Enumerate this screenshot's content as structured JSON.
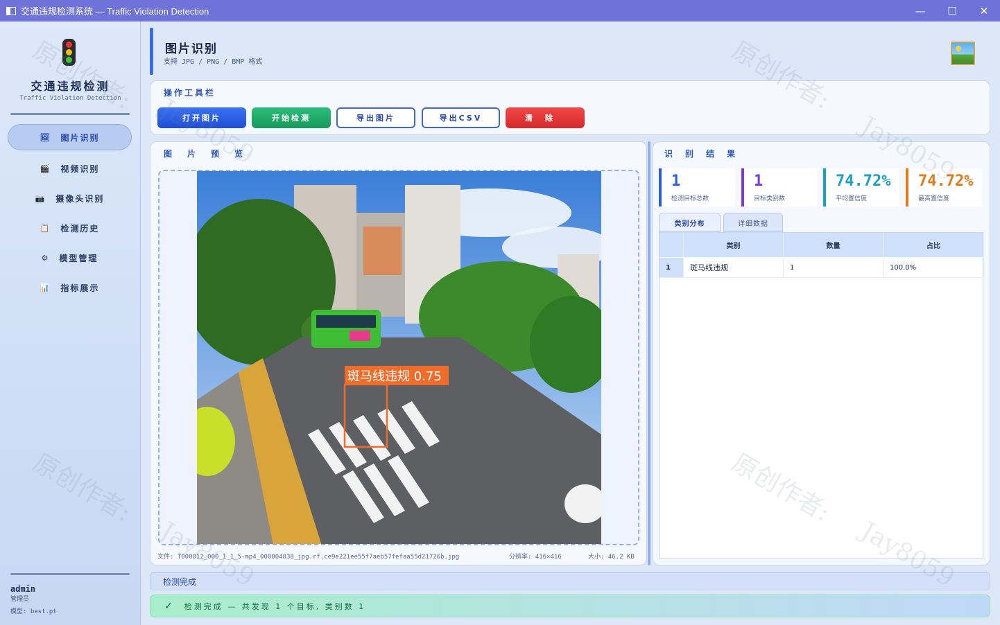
{
  "window": {
    "title": "交通违规检测系统 — Traffic Violation Detection",
    "minimize": "—",
    "maximize": "☐",
    "close": "✕"
  },
  "sidebar": {
    "brand": "交通违规检测",
    "brand_sub": "Traffic Violation Detection",
    "items": [
      {
        "label": "图片识别",
        "icon": "🖼"
      },
      {
        "label": "视频识别",
        "icon": "🎬"
      },
      {
        "label": "摄像头识别",
        "icon": "📷"
      },
      {
        "label": "检测历史",
        "icon": "📋"
      },
      {
        "label": "模型管理",
        "icon": "⚙"
      },
      {
        "label": "指标展示",
        "icon": "📊"
      }
    ],
    "user": "admin",
    "role": "管理员",
    "model": "模型: best.pt"
  },
  "header": {
    "title": "图片识别",
    "subtitle": "支持 JPG / PNG / BMP 格式"
  },
  "toolbar": {
    "title": "操作工具栏",
    "open": "打开图片",
    "start": "开始检测",
    "export_img": "导出图片",
    "export_csv": "导出CSV",
    "clear": "清除"
  },
  "preview": {
    "title": "图片预览",
    "detection_label": "斑马线违规 0.75",
    "file": "文件: T000812_000_1_1_5-mp4_000004838_jpg.rf.ce9e221ee55f7aeb57fefaa55d21726b.jpg",
    "resolution": "分辨率: 416×416",
    "size": "大小: 46.2 KB"
  },
  "results": {
    "title": "识别结果",
    "stats": [
      {
        "value": "1",
        "label": "检测目标总数"
      },
      {
        "value": "1",
        "label": "目标类别数"
      },
      {
        "value": "74.72%",
        "label": "平均置信度"
      },
      {
        "value": "74.72%",
        "label": "最高置信度"
      }
    ],
    "tabs": [
      "类别分布",
      "详细数据"
    ],
    "columns": [
      "类别",
      "数量",
      "占比"
    ],
    "rows": [
      {
        "index": "1",
        "category": "斑马线违规",
        "count": "1",
        "ratio": "100.0%"
      }
    ]
  },
  "status": {
    "line": "检测完成",
    "banner": "检测完成 — 共发现 1 个目标, 类别数 1",
    "check": "✓"
  },
  "watermark": {
    "a": "原创作者:",
    "b": "Jay8059"
  },
  "colors": {
    "accent": "#2f58b8",
    "title_bar": "#6f72d8",
    "stat1": "#2d5fd8",
    "stat2": "#7a3cd8",
    "stat3": "#1aa0c8",
    "stat4": "#e07a1a"
  }
}
